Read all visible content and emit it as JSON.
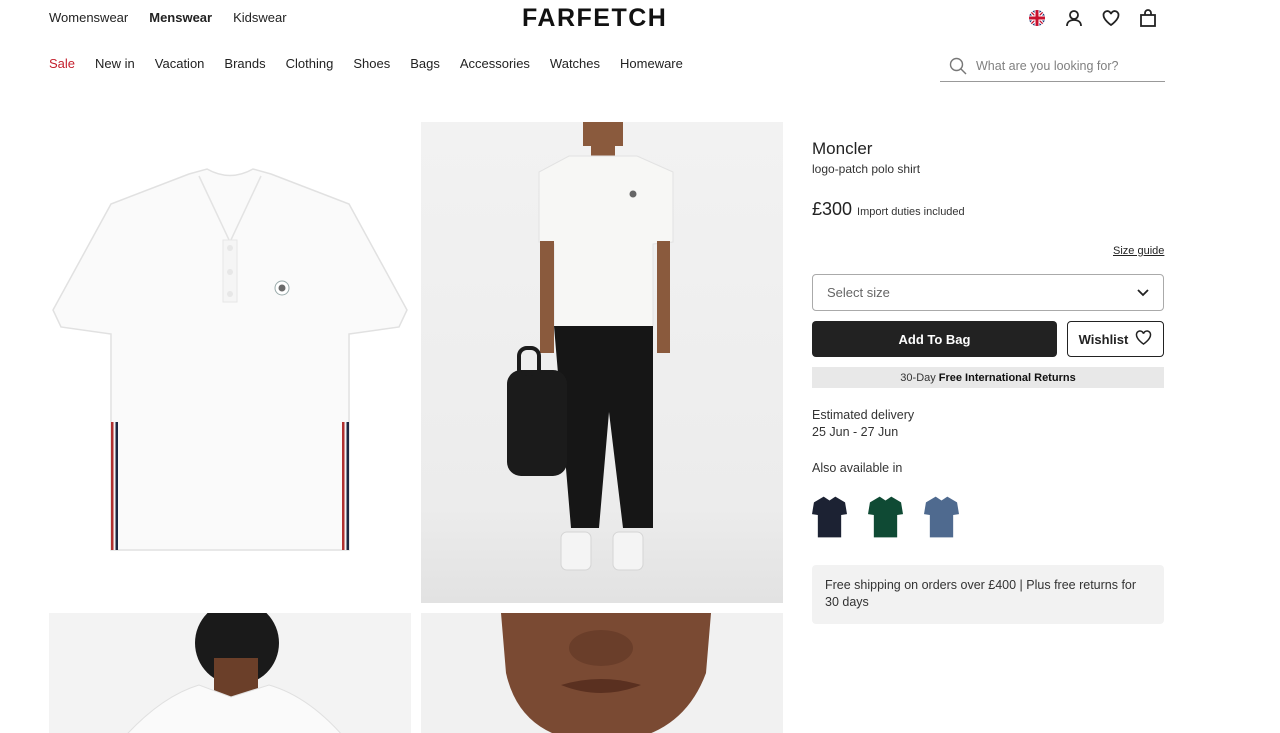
{
  "header": {
    "gender_tabs": [
      {
        "label": "Womenswear",
        "active": false
      },
      {
        "label": "Menswear",
        "active": true
      },
      {
        "label": "Kidswear",
        "active": false
      }
    ],
    "logo": "FARFETCH",
    "icons": [
      "uk-flag-icon",
      "account-icon",
      "wishlist-heart-icon",
      "shopping-bag-icon"
    ]
  },
  "nav": {
    "categories": [
      "Sale",
      "New in",
      "Vacation",
      "Brands",
      "Clothing",
      "Shoes",
      "Bags",
      "Accessories",
      "Watches",
      "Homeware"
    ],
    "sale_color": "#c41f2d"
  },
  "search": {
    "placeholder": "What are you looking for?"
  },
  "product": {
    "brand": "Moncler",
    "name": "logo-patch polo shirt",
    "price": "£300",
    "duties_note": "Import duties included",
    "size_guide_label": "Size guide",
    "size_select_placeholder": "Select size",
    "add_to_bag_label": "Add To Bag",
    "wishlist_label": "Wishlist",
    "returns_prefix": "30-Day",
    "returns_bold": "Free International Returns",
    "delivery_label": "Estimated delivery",
    "delivery_dates": "25 Jun - 27 Jun",
    "also_available_label": "Also available in",
    "swatch_colors": [
      "#1c2233",
      "#0f4a34",
      "#4f6a8f"
    ],
    "shipping_note": "Free shipping on orders over £400 | Plus free returns for 30 days"
  },
  "colors": {
    "primary_button": "#222222",
    "returns_bar_bg": "#e8e8e8"
  }
}
